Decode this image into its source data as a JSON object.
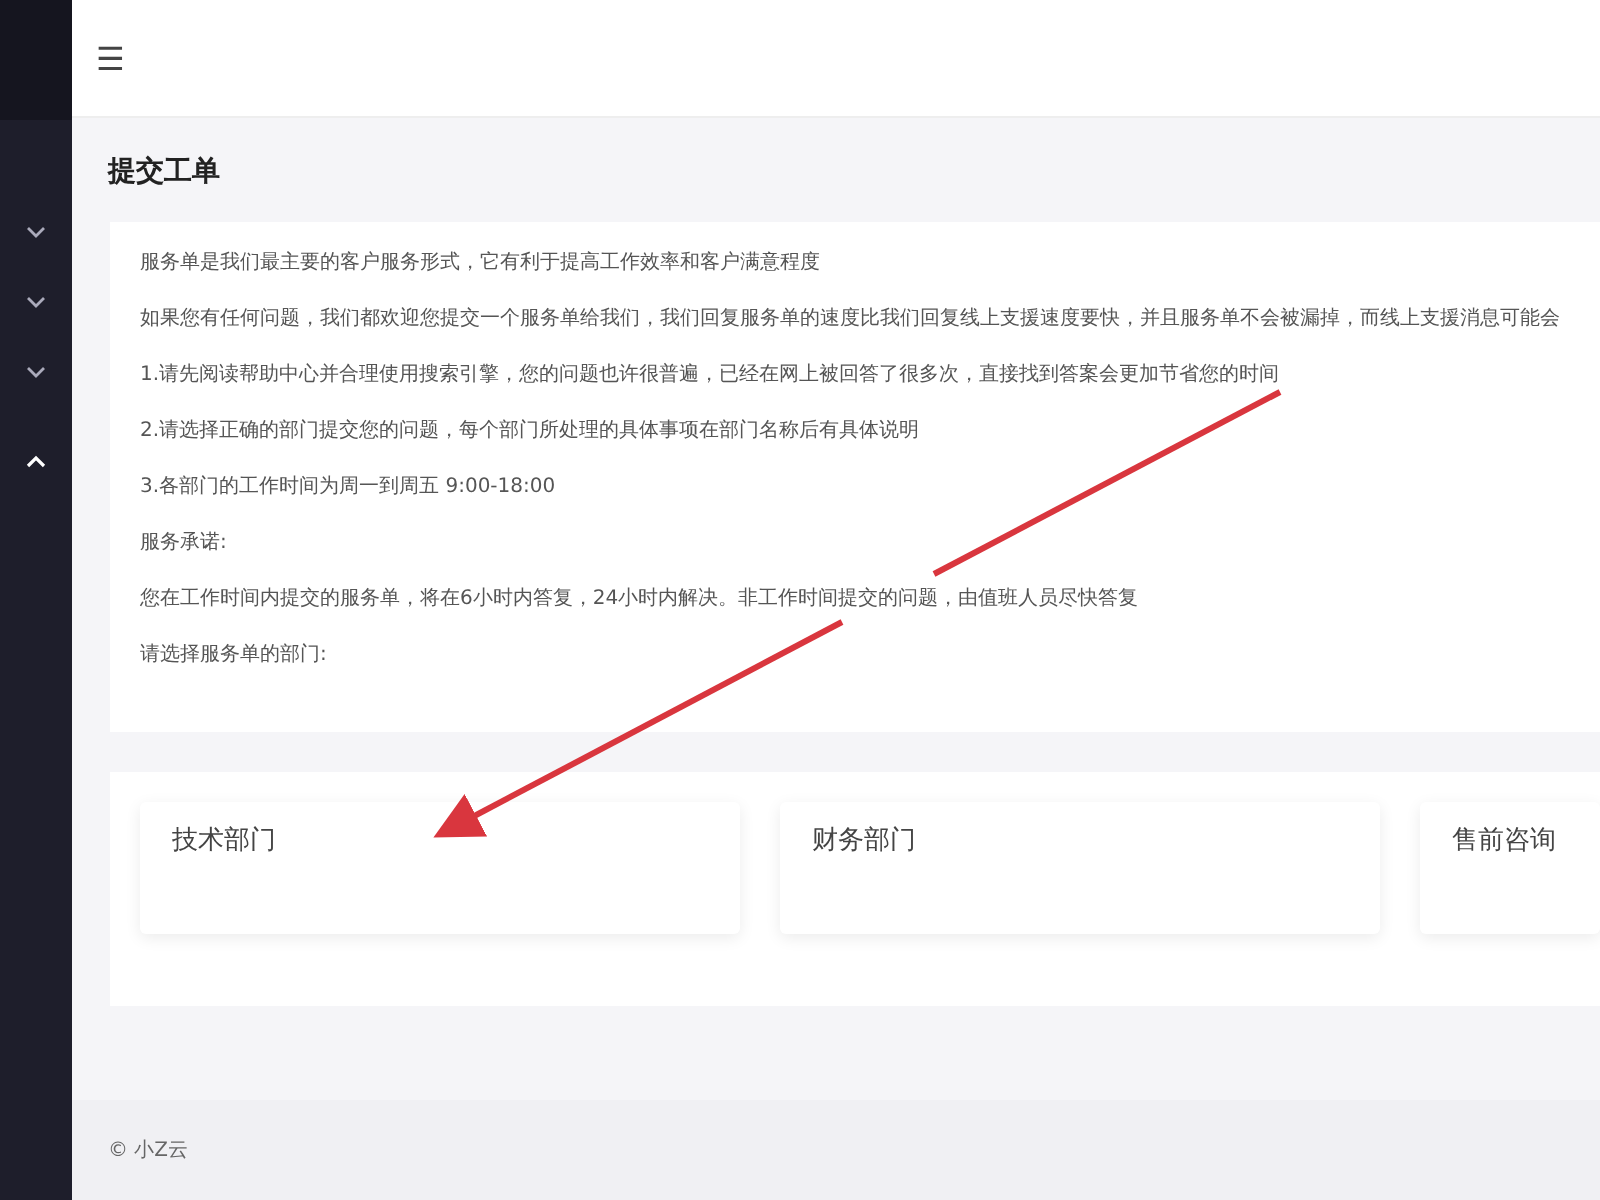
{
  "sidebar": {
    "items": [
      {
        "expanded": false
      },
      {
        "expanded": false
      },
      {
        "expanded": false
      },
      {
        "expanded": true
      }
    ]
  },
  "topbar": {
    "menu_icon": "☰"
  },
  "page_title": "提交工单",
  "intro": [
    "服务单是我们最主要的客户服务形式，它有利于提高工作效率和客户满意程度",
    "如果您有任何问题，我们都欢迎您提交一个服务单给我们，我们回复服务单的速度比我们回复线上支援速度要快，并且服务单不会被漏掉，而线上支援消息可能会",
    "1.请先阅读帮助中心并合理使用搜索引擎，您的问题也许很普遍，已经在网上被回答了很多次，直接找到答案会更加节省您的时间",
    "2.请选择正确的部门提交您的问题，每个部门所处理的具体事项在部门名称后有具体说明",
    "3.各部门的工作时间为周一到周五 9:00-18:00",
    "服务承诺:",
    "您在工作时间内提交的服务单，将在6小时内答复，24小时内解决。非工作时间提交的问题，由值班人员尽快答复",
    "请选择服务单的部门:"
  ],
  "departments": [
    {
      "name": "技术部门"
    },
    {
      "name": "财务部门"
    },
    {
      "name": "售前咨询"
    }
  ],
  "footer": "© 小Z云"
}
